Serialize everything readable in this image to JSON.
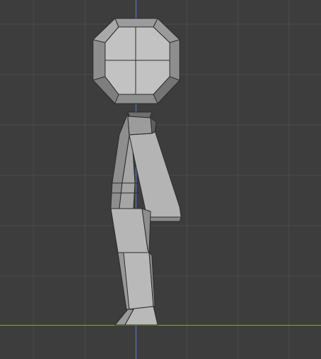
{
  "viewport": {
    "view": "side",
    "background": "#3d3d3d",
    "grid_color": "#4a4a4a",
    "z_axis_color": "#5a7ccf",
    "y_axis_color": "#7fa83a"
  },
  "model": {
    "type": "low-poly humanoid",
    "parts": [
      "head",
      "torso",
      "arm",
      "leg",
      "foot"
    ],
    "face_colors": {
      "light": "#b9b9b9",
      "mid": "#a3a3a3",
      "dark": "#8e8e8e",
      "shadow": "#6f6f6f",
      "edge": "#2c2c2c"
    }
  }
}
